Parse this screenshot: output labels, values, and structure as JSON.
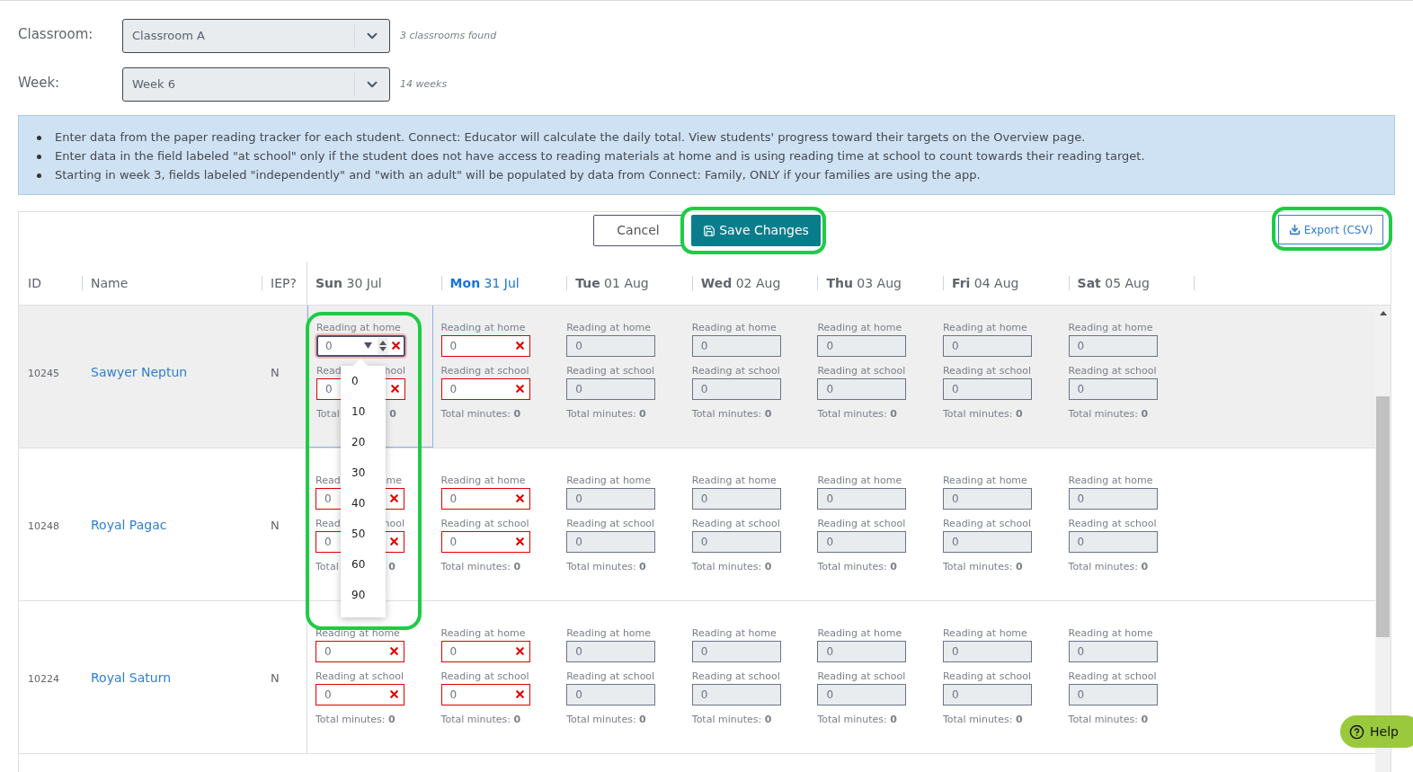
{
  "filters": [
    {
      "label": "Classroom:",
      "value": "Classroom A",
      "hint": "3 classrooms found"
    },
    {
      "label": "Week:",
      "value": "Week 6",
      "hint": "14 weeks"
    }
  ],
  "info": [
    "Enter data from the paper reading tracker for each student. Connect: Educator will calculate the daily total. View students' progress toward their targets on the Overview page.",
    "Enter data in the field labeled \"at school\" only if the student does not have access to reading materials at home and is using reading time at school to count towards their reading target.",
    "Starting in week 3, fields labeled \"independently\" and \"with an adult\" will be populated by data from Connect: Family, ONLY if your families are using the app."
  ],
  "toolbar": {
    "cancel": "Cancel",
    "save": "Save Changes",
    "export": "Export (CSV)"
  },
  "columns": [
    "ID",
    "Name",
    "IEP?"
  ],
  "days": [
    {
      "label": "**Sun** 30 Jul",
      "today": false
    },
    {
      "label": "**Mon** 31 Jul",
      "today": true
    },
    {
      "label": "**Tue** 01 Aug",
      "today": false
    },
    {
      "label": "**Wed** 02 Aug",
      "today": false
    },
    {
      "label": "**Thu** 03 Aug",
      "today": false
    },
    {
      "label": "**Fri** 04 Aug",
      "today": false
    },
    {
      "label": "**Sat** 05 Aug",
      "today": false
    }
  ],
  "rows": [
    {
      "id": "10245",
      "name": "Sawyer Neptun",
      "iep": "N",
      "selected": true,
      "cells": [
        {
          "disabled": false,
          "home_label": "Reading at home",
          "home": "0",
          "home_focused": true,
          "options": [
            "0",
            "10",
            "20",
            "30",
            "40",
            "50",
            "60",
            "90"
          ],
          "school_label": [
            "Read",
            "hool"
          ],
          "school": "0",
          "total": [
            "Total",
            ": **0**"
          ]
        },
        {
          "disabled": false,
          "home_label": "Reading at home",
          "home": "0",
          "home_focused": false,
          "school_label": "Reading at school",
          "school": "0",
          "total": "Total minutes: **0**"
        },
        {
          "disabled": true,
          "home_label": "Reading at home",
          "home": "0",
          "home_focused": false,
          "school_label": "Reading at school",
          "school": "0",
          "total": "Total minutes: **0**"
        },
        {
          "disabled": true,
          "home_label": "Reading at home",
          "home": "0",
          "home_focused": false,
          "school_label": "Reading at school",
          "school": "0",
          "total": "Total minutes: **0**"
        },
        {
          "disabled": true,
          "home_label": "Reading at home",
          "home": "0",
          "home_focused": false,
          "school_label": "Reading at school",
          "school": "0",
          "total": "Total minutes: **0**"
        },
        {
          "disabled": true,
          "home_label": "Reading at home",
          "home": "0",
          "home_focused": false,
          "school_label": "Reading at school",
          "school": "0",
          "total": "Total minutes: **0**"
        },
        {
          "disabled": true,
          "home_label": "Reading at home",
          "home": "0",
          "home_focused": false,
          "school_label": "Reading at school",
          "school": "0",
          "total": "Total minutes: **0**"
        }
      ]
    },
    {
      "id": "10248",
      "name": "Royal Pagac",
      "iep": "N",
      "selected": false,
      "cells": [
        {
          "disabled": false,
          "home_label": [
            "Read",
            "me"
          ],
          "home": "0",
          "home_focused": false,
          "school_label": [
            "Read",
            "hool"
          ],
          "school": "0",
          "total": [
            "Total",
            ": **0**"
          ]
        },
        {
          "disabled": false,
          "home_label": "Reading at home",
          "home": "0",
          "home_focused": false,
          "school_label": "Reading at school",
          "school": "0",
          "total": "Total minutes: **0**"
        },
        {
          "disabled": true,
          "home_label": "Reading at home",
          "home": "0",
          "home_focused": false,
          "school_label": "Reading at school",
          "school": "0",
          "total": "Total minutes: **0**"
        },
        {
          "disabled": true,
          "home_label": "Reading at home",
          "home": "0",
          "home_focused": false,
          "school_label": "Reading at school",
          "school": "0",
          "total": "Total minutes: **0**"
        },
        {
          "disabled": true,
          "home_label": "Reading at home",
          "home": "0",
          "home_focused": false,
          "school_label": "Reading at school",
          "school": "0",
          "total": "Total minutes: **0**"
        },
        {
          "disabled": true,
          "home_label": "Reading at home",
          "home": "0",
          "home_focused": false,
          "school_label": "Reading at school",
          "school": "0",
          "total": "Total minutes: **0**"
        },
        {
          "disabled": true,
          "home_label": "Reading at home",
          "home": "0",
          "home_focused": false,
          "school_label": "Reading at school",
          "school": "0",
          "total": "Total minutes: **0**"
        }
      ]
    },
    {
      "id": "10224",
      "name": "Royal Saturn",
      "iep": "N",
      "selected": false,
      "cells": [
        {
          "disabled": false,
          "home_label": "Reading at home",
          "home": "0",
          "home_focused": false,
          "school_label": "Reading at school",
          "school": "0",
          "total": "Total minutes: **0**"
        },
        {
          "disabled": false,
          "home_label": "Reading at home",
          "home": "0",
          "home_focused": false,
          "school_label": "Reading at school",
          "school": "0",
          "total": "Total minutes: **0**"
        },
        {
          "disabled": true,
          "home_label": "Reading at home",
          "home": "0",
          "home_focused": false,
          "school_label": "Reading at school",
          "school": "0",
          "total": "Total minutes: **0**"
        },
        {
          "disabled": true,
          "home_label": "Reading at home",
          "home": "0",
          "home_focused": false,
          "school_label": "Reading at school",
          "school": "0",
          "total": "Total minutes: **0**"
        },
        {
          "disabled": true,
          "home_label": "Reading at home",
          "home": "0",
          "home_focused": false,
          "school_label": "Reading at school",
          "school": "0",
          "total": "Total minutes: **0**"
        },
        {
          "disabled": true,
          "home_label": "Reading at home",
          "home": "0",
          "home_focused": false,
          "school_label": "Reading at school",
          "school": "0",
          "total": "Total minutes: **0**"
        },
        {
          "disabled": true,
          "home_label": "Reading at home",
          "home": "0",
          "home_focused": false,
          "school_label": "Reading at school",
          "school": "0",
          "total": "Total minutes: **0**"
        }
      ]
    }
  ],
  "help": "Help"
}
